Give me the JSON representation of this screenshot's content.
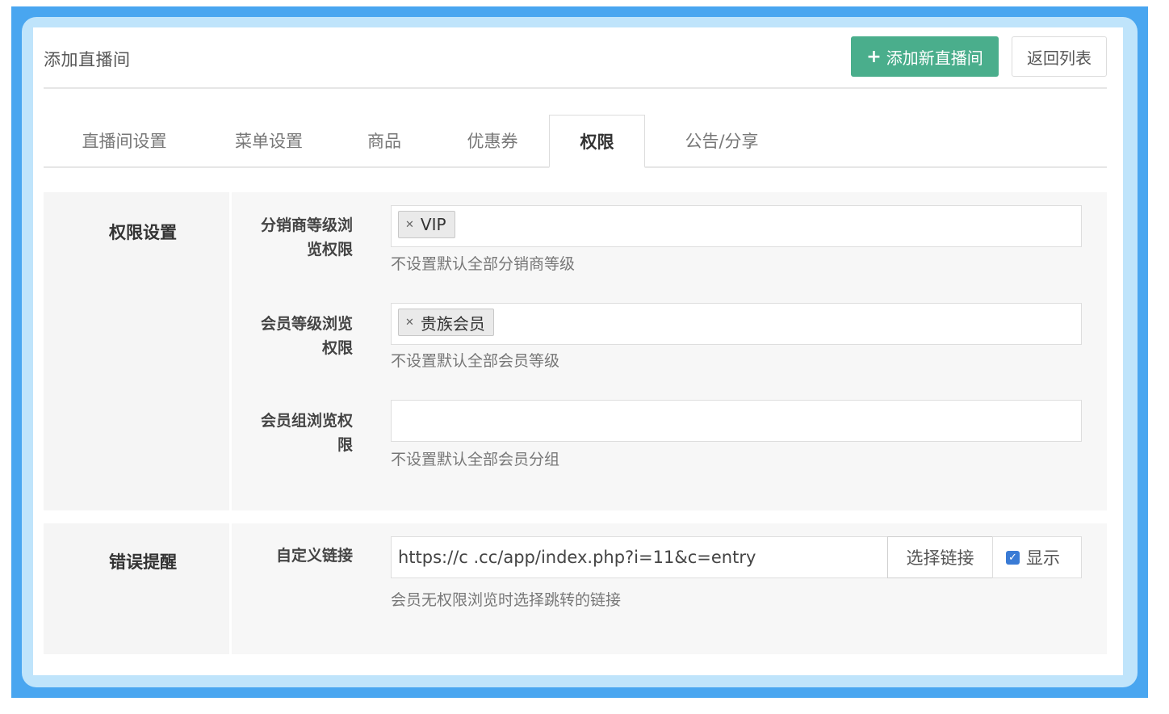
{
  "header": {
    "title": "添加直播间",
    "add_button": "添加新直播间",
    "back_button": "返回列表"
  },
  "tabs": [
    {
      "label": "直播间设置"
    },
    {
      "label": "菜单设置"
    },
    {
      "label": "商品"
    },
    {
      "label": "优惠券"
    },
    {
      "label": "权限",
      "active": true
    },
    {
      "label": "公告/分享"
    }
  ],
  "permissions": {
    "title": "权限设置",
    "distributor": {
      "label_line1": "分销商等级浏",
      "label_line2": "览权限",
      "tag": "VIP",
      "help": "不设置默认全部分销商等级"
    },
    "member_level": {
      "label_line1": "会员等级浏览",
      "label_line2": "权限",
      "tag": "贵族会员",
      "help": "不设置默认全部会员等级"
    },
    "member_group": {
      "label_line1": "会员组浏览权",
      "label_line2": "限",
      "value": "",
      "help": "不设置默认全部会员分组"
    }
  },
  "error_reminder": {
    "title": "错误提醒",
    "link_label": "自定义链接",
    "link_value": "https://c                  .cc/app/index.php?i=11&c=entry",
    "select_link_button": "选择链接",
    "show_checkbox": {
      "label": "显示",
      "checked": true
    },
    "help": "会员无权限浏览时选择跳转的链接"
  },
  "colors": {
    "accent_green": "#4aae8c",
    "frame_blue": "#49a6f0",
    "checkbox_blue": "#3a7bd5"
  }
}
